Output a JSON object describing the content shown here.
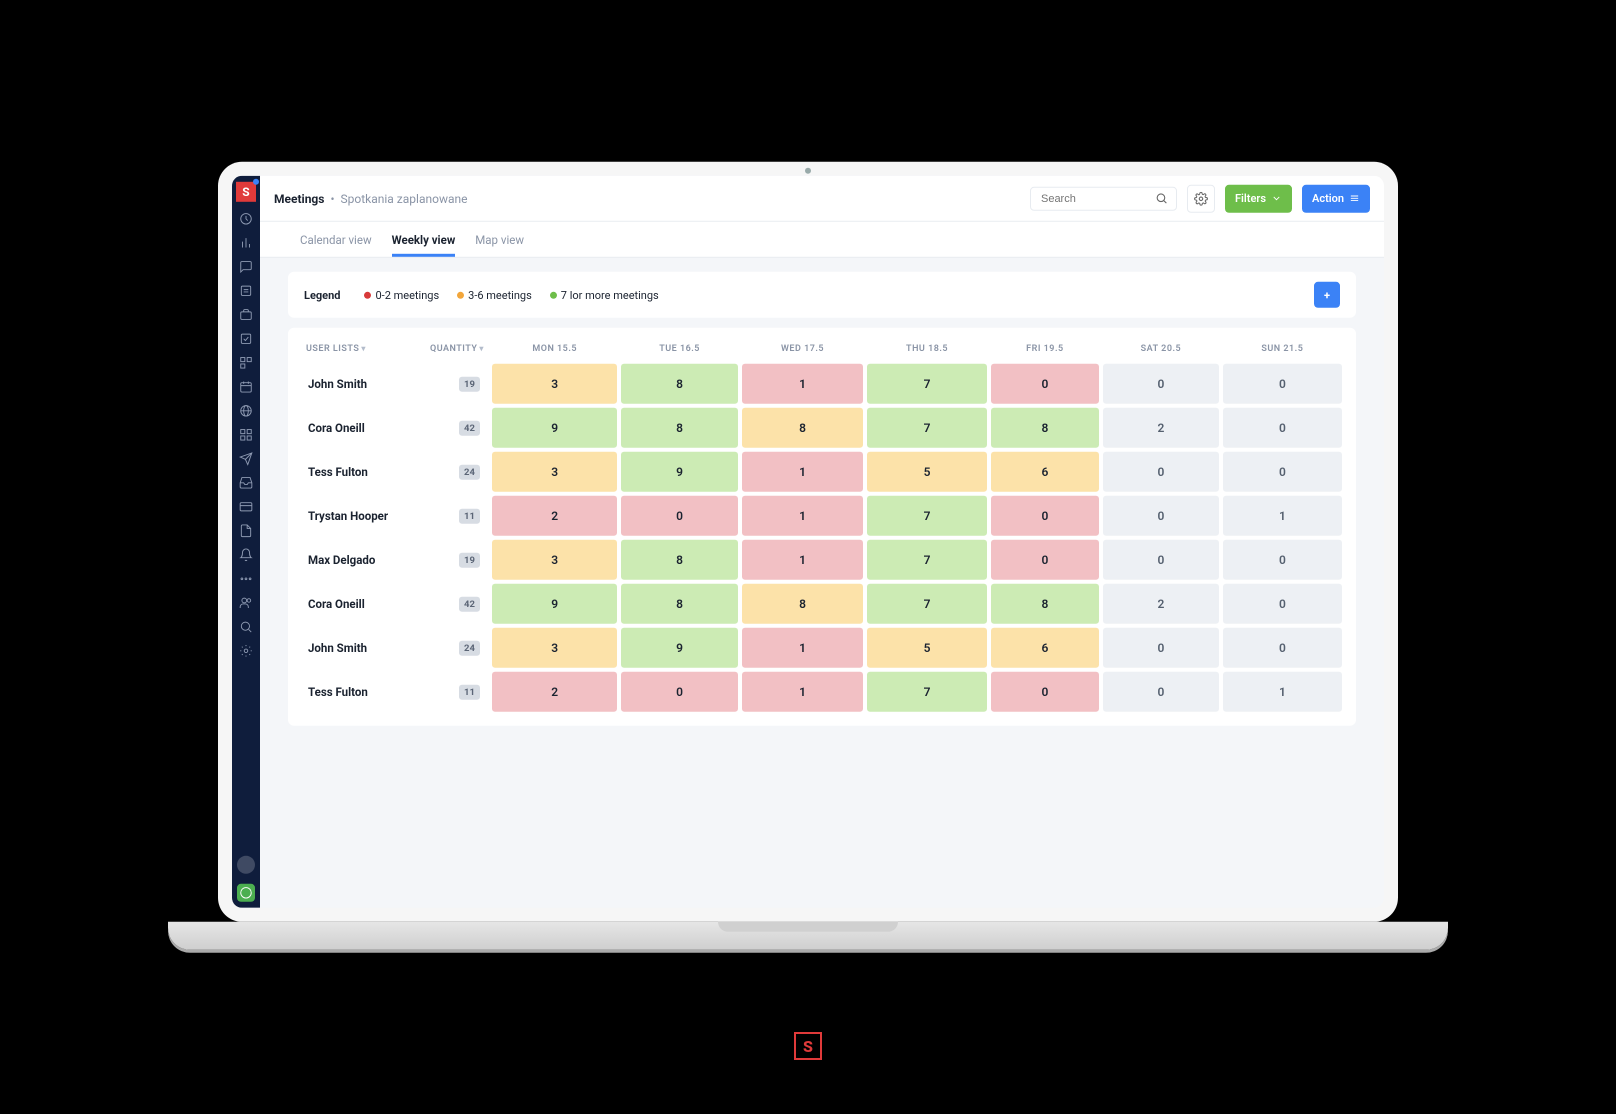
{
  "colors": {
    "cell_green": "#CCEBB4",
    "cell_orange": "#FCE2A9",
    "cell_red": "#F2C0C4",
    "cell_grey": "#EDF0F4",
    "accent_blue": "#3B82F6",
    "accent_green": "#6EBE4A"
  },
  "sidebar": {
    "logo_letter": "S",
    "items": [
      "dashboard",
      "analytics",
      "chat",
      "reports",
      "projects",
      "tasks",
      "pipeline",
      "calendar",
      "globe",
      "grid",
      "send",
      "inbox",
      "card",
      "documents",
      "bell",
      "more",
      "users",
      "search",
      "settings"
    ]
  },
  "header": {
    "title": "Meetings",
    "subtitle": "Spotkania zaplanowane",
    "search_placeholder": "Search",
    "filters_label": "Filters",
    "action_label": "Action"
  },
  "tabs": [
    {
      "id": "calendar",
      "label": "Calendar view",
      "active": false
    },
    {
      "id": "weekly",
      "label": "Weekly view",
      "active": true
    },
    {
      "id": "map",
      "label": "Map view",
      "active": false
    }
  ],
  "legend": {
    "title": "Legend",
    "items": [
      {
        "color": "r",
        "label": "0-2 meetings"
      },
      {
        "color": "o",
        "label": "3-6 meetings"
      },
      {
        "color": "g",
        "label": "7 lor more meetings"
      }
    ],
    "add_label": "+"
  },
  "table": {
    "headers": {
      "user": "User lists",
      "quantity": "Quantity",
      "days": [
        "MON 15.5",
        "TUE 16.5",
        "WED 17.5",
        "THU 18.5",
        "FRI 19.5",
        "SAT 20.5",
        "SUN 21.5"
      ]
    },
    "rows": [
      {
        "user": "John Smith",
        "qty": "19",
        "cells": [
          {
            "v": "3",
            "c": "orange"
          },
          {
            "v": "8",
            "c": "green"
          },
          {
            "v": "1",
            "c": "red"
          },
          {
            "v": "7",
            "c": "green"
          },
          {
            "v": "0",
            "c": "red"
          },
          {
            "v": "0",
            "c": "grey"
          },
          {
            "v": "0",
            "c": "grey"
          }
        ]
      },
      {
        "user": "Cora Oneill",
        "qty": "42",
        "cells": [
          {
            "v": "9",
            "c": "green"
          },
          {
            "v": "8",
            "c": "green"
          },
          {
            "v": "8",
            "c": "orange"
          },
          {
            "v": "7",
            "c": "green"
          },
          {
            "v": "8",
            "c": "green"
          },
          {
            "v": "2",
            "c": "grey"
          },
          {
            "v": "0",
            "c": "grey"
          }
        ]
      },
      {
        "user": "Tess Fulton",
        "qty": "24",
        "cells": [
          {
            "v": "3",
            "c": "orange"
          },
          {
            "v": "9",
            "c": "green"
          },
          {
            "v": "1",
            "c": "red"
          },
          {
            "v": "5",
            "c": "orange"
          },
          {
            "v": "6",
            "c": "orange"
          },
          {
            "v": "0",
            "c": "grey"
          },
          {
            "v": "0",
            "c": "grey"
          }
        ]
      },
      {
        "user": "Trystan Hooper",
        "qty": "11",
        "cells": [
          {
            "v": "2",
            "c": "red"
          },
          {
            "v": "0",
            "c": "red"
          },
          {
            "v": "1",
            "c": "red"
          },
          {
            "v": "7",
            "c": "green"
          },
          {
            "v": "0",
            "c": "red"
          },
          {
            "v": "0",
            "c": "grey"
          },
          {
            "v": "1",
            "c": "grey"
          }
        ]
      },
      {
        "user": "Max Delgado",
        "qty": "19",
        "cells": [
          {
            "v": "3",
            "c": "orange"
          },
          {
            "v": "8",
            "c": "green"
          },
          {
            "v": "1",
            "c": "red"
          },
          {
            "v": "7",
            "c": "green"
          },
          {
            "v": "0",
            "c": "red"
          },
          {
            "v": "0",
            "c": "grey"
          },
          {
            "v": "0",
            "c": "grey"
          }
        ]
      },
      {
        "user": "Cora Oneill",
        "qty": "42",
        "cells": [
          {
            "v": "9",
            "c": "green"
          },
          {
            "v": "8",
            "c": "green"
          },
          {
            "v": "8",
            "c": "orange"
          },
          {
            "v": "7",
            "c": "green"
          },
          {
            "v": "8",
            "c": "green"
          },
          {
            "v": "2",
            "c": "grey"
          },
          {
            "v": "0",
            "c": "grey"
          }
        ]
      },
      {
        "user": "John Smith",
        "qty": "24",
        "cells": [
          {
            "v": "3",
            "c": "orange"
          },
          {
            "v": "9",
            "c": "green"
          },
          {
            "v": "1",
            "c": "red"
          },
          {
            "v": "5",
            "c": "orange"
          },
          {
            "v": "6",
            "c": "orange"
          },
          {
            "v": "0",
            "c": "grey"
          },
          {
            "v": "0",
            "c": "grey"
          }
        ]
      },
      {
        "user": "Tess Fulton",
        "qty": "11",
        "cells": [
          {
            "v": "2",
            "c": "red"
          },
          {
            "v": "0",
            "c": "red"
          },
          {
            "v": "1",
            "c": "red"
          },
          {
            "v": "7",
            "c": "green"
          },
          {
            "v": "0",
            "c": "red"
          },
          {
            "v": "0",
            "c": "grey"
          },
          {
            "v": "1",
            "c": "grey"
          }
        ]
      }
    ]
  },
  "footer": {
    "brand_letter": "S"
  }
}
